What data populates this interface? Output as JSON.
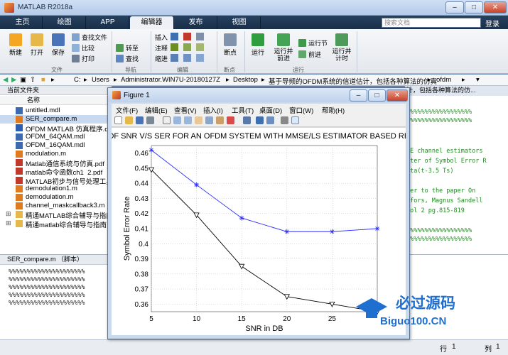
{
  "window": {
    "title": "MATLAB R2018a",
    "min": "–",
    "max": "□",
    "close": "✕"
  },
  "tabs": [
    "主页",
    "绘图",
    "APP",
    "编辑器",
    "发布",
    "视图"
  ],
  "search_placeholder": "搜索文档",
  "login_label": "登录",
  "ribbon": {
    "file": {
      "new": "新建",
      "open": "打开",
      "save": "保存",
      "find_files": "查找文件",
      "compare": "比较",
      "print": "打印",
      "group": "文件"
    },
    "navigate": {
      "goto": "转至",
      "find": "查找",
      "group": "导航"
    },
    "edit": {
      "insert": "插入",
      "comment": "注释",
      "indent": "缩进",
      "group": "编辑"
    },
    "breakpoint": {
      "label": "断点",
      "group": "断点"
    },
    "run": {
      "run": "运行",
      "run_advance": "运行并前进",
      "run_section": "运行节",
      "advance": "前进",
      "run_time": "运行并计时",
      "group": "运行"
    }
  },
  "address": {
    "parts": [
      "C:",
      "Users",
      "Administrator.WIN7U-20180127Z",
      "Desktop",
      "基于导频的OFDM系统的信道估计，包括各种算法的仿真",
      "ofdm"
    ]
  },
  "current_folder": {
    "title": "当前文件夹",
    "column": "名称",
    "files": [
      {
        "name": "untitled.mdl",
        "type": "mdl"
      },
      {
        "name": "SER_compare.m",
        "type": "m",
        "selected": true
      },
      {
        "name": "OFDM MATLAB 仿真程序.de",
        "type": "doc"
      },
      {
        "name": "OFDM_64QAM.mdl",
        "type": "mdl"
      },
      {
        "name": "OFDM_16QAM.mdl",
        "type": "mdl"
      },
      {
        "name": "modulation.m",
        "type": "m"
      },
      {
        "name": "Matlab通信系统与仿真.pdf",
        "type": "pdf"
      },
      {
        "name": "matlab命令函数ch1_2.pdf",
        "type": "pdf"
      },
      {
        "name": "MATLAB初步与信号处理工具",
        "type": "pdf"
      },
      {
        "name": "demodulation1.m",
        "type": "m"
      },
      {
        "name": "demodulation.m",
        "type": "m"
      },
      {
        "name": "channel_maskcallback3.m",
        "type": "m"
      },
      {
        "name": "精通MATLAB综合辅导与指南",
        "type": "folder"
      },
      {
        "name": "精通matlab综合辅导与指南",
        "type": "folder"
      }
    ]
  },
  "details": {
    "title": "SER_compare.m （脚本）",
    "lines": [
      "%%%%%%%%%%%%%%%%%%%%%",
      "%%%%%%%%%%%%%%%%%%%%%",
      "%%%%%%%%%%%%%%%%%%%%%",
      "%%%%%%%%%%%%%%%%%%%%%",
      "%%%%%%%%%%%%%%%%%%%%%"
    ]
  },
  "editor_peek": {
    "tab_text": "计，包括各种算法的仿...",
    "lines": [
      "%%%%%%%%%%%%%%%%%%",
      "%%%%%%%%%%%%%%%%%%",
      "",
      "SE channel estimators",
      "eter of Symbol Error R",
      "lta(t-3.5 Ts)",
      "",
      "fer to the paper On",
      "dfors, Magnus Sandell",
      "Vol 2 pg.815-819",
      "",
      "%%%%%%%%%%%%%%%%%%",
      "%%%%%%%%%%%%%%%%%%"
    ]
  },
  "status": {
    "row_label": "行",
    "row_value": "1",
    "col_label": "列",
    "col_value": "1"
  },
  "figure": {
    "title": "Figure 1",
    "menu": [
      "文件(F)",
      "编辑(E)",
      "查看(V)",
      "插入(I)",
      "工具(T)",
      "桌面(D)",
      "窗口(W)",
      "帮助(H)"
    ]
  },
  "watermark": {
    "brand": "必过源码",
    "url": "Biguo100.CN"
  },
  "colors": {
    "blue_series": "#2a2aff",
    "black_series": "#000000",
    "accent": "#1a2f49"
  },
  "chart_data": {
    "type": "line",
    "title": "OF SNR V/S SER FOR AN OFDM SYSTEM WITH MMSE/LS ESTIMATOR BASED RE",
    "xlabel": "SNR in DB",
    "ylabel": "Symbol Error Rate",
    "xlim": [
      5,
      30
    ],
    "ylim": [
      0.355,
      0.465
    ],
    "xticks": [
      5,
      10,
      15,
      20,
      25
    ],
    "yticks": [
      0.36,
      0.37,
      0.38,
      0.39,
      0.4,
      0.41,
      0.42,
      0.43,
      0.44,
      0.45,
      0.46
    ],
    "grid": true,
    "x": [
      5,
      10,
      15,
      20,
      25,
      30
    ],
    "series": [
      {
        "marker": "star",
        "color": "#2a2aff",
        "values": [
          0.462,
          0.439,
          0.417,
          0.408,
          0.408,
          0.41
        ]
      },
      {
        "marker": "triangle-down",
        "color": "#000000",
        "values": [
          0.449,
          0.419,
          0.385,
          0.365,
          0.36,
          0.355
        ]
      }
    ]
  }
}
